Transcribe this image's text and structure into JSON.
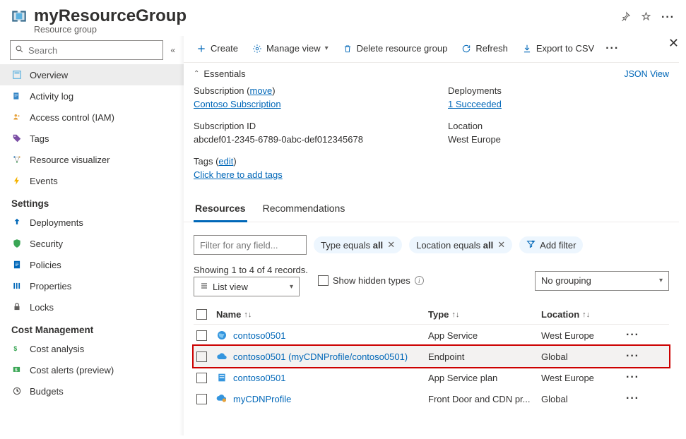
{
  "header": {
    "title": "myResourceGroup",
    "subtitle": "Resource group"
  },
  "sidebar": {
    "search_placeholder": "Search",
    "items_top": [
      {
        "label": "Overview"
      },
      {
        "label": "Activity log"
      },
      {
        "label": "Access control (IAM)"
      },
      {
        "label": "Tags"
      },
      {
        "label": "Resource visualizer"
      },
      {
        "label": "Events"
      }
    ],
    "section_settings": "Settings",
    "items_settings": [
      {
        "label": "Deployments"
      },
      {
        "label": "Security"
      },
      {
        "label": "Policies"
      },
      {
        "label": "Properties"
      },
      {
        "label": "Locks"
      }
    ],
    "section_cost": "Cost Management",
    "items_cost": [
      {
        "label": "Cost analysis"
      },
      {
        "label": "Cost alerts (preview)"
      },
      {
        "label": "Budgets"
      }
    ]
  },
  "toolbar": {
    "create": "Create",
    "manage_view": "Manage view",
    "delete": "Delete resource group",
    "refresh": "Refresh",
    "export": "Export to CSV"
  },
  "essentials": {
    "title": "Essentials",
    "json_view": "JSON View",
    "subscription_label": "Subscription",
    "move": "move",
    "subscription_value": "Contoso Subscription",
    "subscription_id_label": "Subscription ID",
    "subscription_id_value": "abcdef01-2345-6789-0abc-def012345678",
    "tags_label": "Tags",
    "edit": "edit",
    "tags_value": "Click here to add tags",
    "deployments_label": "Deployments",
    "deployments_value": "1 Succeeded",
    "location_label": "Location",
    "location_value": "West Europe"
  },
  "tabs": {
    "resources": "Resources",
    "recommendations": "Recommendations"
  },
  "filters": {
    "placeholder": "Filter for any field...",
    "type_pill_a": "Type equals ",
    "type_pill_b": "all",
    "location_pill_a": "Location equals ",
    "location_pill_b": "all",
    "add_filter": "Add filter"
  },
  "controls": {
    "records": "Showing 1 to 4 of 4 records.",
    "list_view": "List view",
    "hidden_types": "Show hidden types",
    "grouping": "No grouping"
  },
  "table": {
    "headers": {
      "name": "Name",
      "type": "Type",
      "location": "Location"
    },
    "rows": [
      {
        "name": "contoso0501",
        "type": "App Service",
        "location": "West Europe",
        "icon": "globe"
      },
      {
        "name": "contoso0501 (myCDNProfile/contoso0501)",
        "type": "Endpoint",
        "location": "Global",
        "icon": "cloud",
        "highlighted": true
      },
      {
        "name": "contoso0501",
        "type": "App Service plan",
        "location": "West Europe",
        "icon": "plan"
      },
      {
        "name": "myCDNProfile",
        "type": "Front Door and CDN pr...",
        "location": "Global",
        "icon": "cdn"
      }
    ]
  }
}
